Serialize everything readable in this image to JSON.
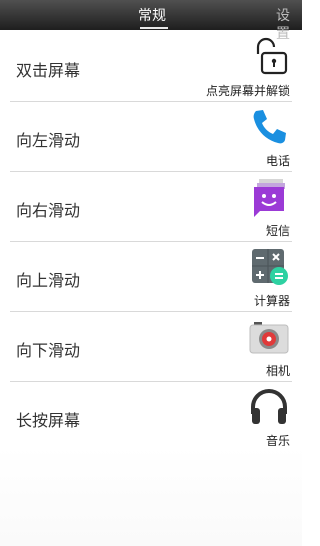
{
  "tabs": {
    "general": "常规",
    "settings": "设置"
  },
  "rows": [
    {
      "gesture": "双击屏幕",
      "app": "点亮屏幕并解锁",
      "icon": "padlock-icon"
    },
    {
      "gesture": "向左滑动",
      "app": "电话",
      "icon": "phone-icon"
    },
    {
      "gesture": "向右滑动",
      "app": "短信",
      "icon": "messaging-icon"
    },
    {
      "gesture": "向上滑动",
      "app": "计算器",
      "icon": "calculator-icon"
    },
    {
      "gesture": "向下滑动",
      "app": "相机",
      "icon": "camera-icon"
    },
    {
      "gesture": "长按屏幕",
      "app": "音乐",
      "icon": "headphones-icon"
    }
  ],
  "colors": {
    "phone": "#1a8fe0",
    "messaging": "#9b3ad6",
    "calculator_badge": "#2ed1a2",
    "camera_lens": "#e03a3a"
  }
}
